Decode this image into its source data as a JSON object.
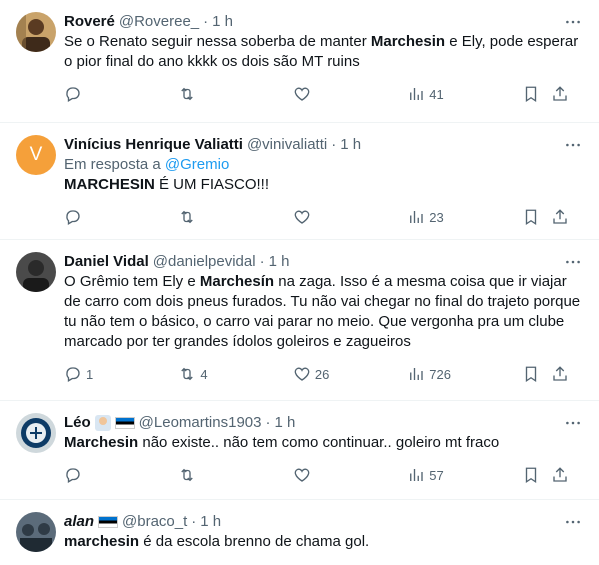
{
  "tweets": [
    {
      "name": "Roveré",
      "handle": "@Roveree_",
      "time": "1 h",
      "text_parts": [
        "Se o Renato seguir nessa soberba de manter ",
        "Marchesin",
        " e Ely, pode esperar o pior final do ano kkkk os dois são MT ruins"
      ],
      "replies": "",
      "retweets": "",
      "likes": "",
      "views": "41",
      "avatar_icon": "person-photo-avatar"
    },
    {
      "name": "Vinícius Henrique Valiatti",
      "handle": "@vinivaliatti",
      "time": "1 h",
      "reply_prefix": "Em resposta a ",
      "reply_to": "@Gremio",
      "text_parts": [
        "MARCHESIN",
        " É UM FIASCO!!!",
        ""
      ],
      "replies": "",
      "retweets": "",
      "likes": "",
      "views": "23",
      "avatar_initial": "V",
      "avatar_color": "#f5a03a"
    },
    {
      "name": "Daniel Vidal",
      "handle": "@danielpevidal",
      "time": "1 h",
      "text_parts": [
        "O Grêmio tem Ely e ",
        "Marchesín",
        " na zaga. Isso é a mesma coisa que ir viajar de carro com dois pneus furados. Tu não vai chegar no final do trajeto porque tu não tem o básico, o carro vai parar no meio. Que vergonha pra um clube marcado por ter grandes ídolos goleiros e zagueiros"
      ],
      "replies": "1",
      "retweets": "4",
      "likes": "26",
      "views": "726",
      "avatar_icon": "person-photo-avatar"
    },
    {
      "name": "Léo",
      "handle": "@Leomartins1903",
      "time": "1 h",
      "text_parts": [
        "Marchesin",
        " não existe.. não tem como continuar.. goleiro mt fraco",
        ""
      ],
      "replies": "",
      "retweets": "",
      "likes": "",
      "views": "57",
      "avatar_icon": "team-crest-avatar"
    },
    {
      "name": "alan",
      "handle": "@braco_t",
      "time": "1 h",
      "text_parts": [
        "marchesin",
        " é da escola brenno de chama gol.",
        ""
      ],
      "avatar_icon": "group-photo-avatar"
    }
  ],
  "colors": {
    "link": "#1d9bf0",
    "muted": "#536471",
    "text": "#0f1419"
  }
}
